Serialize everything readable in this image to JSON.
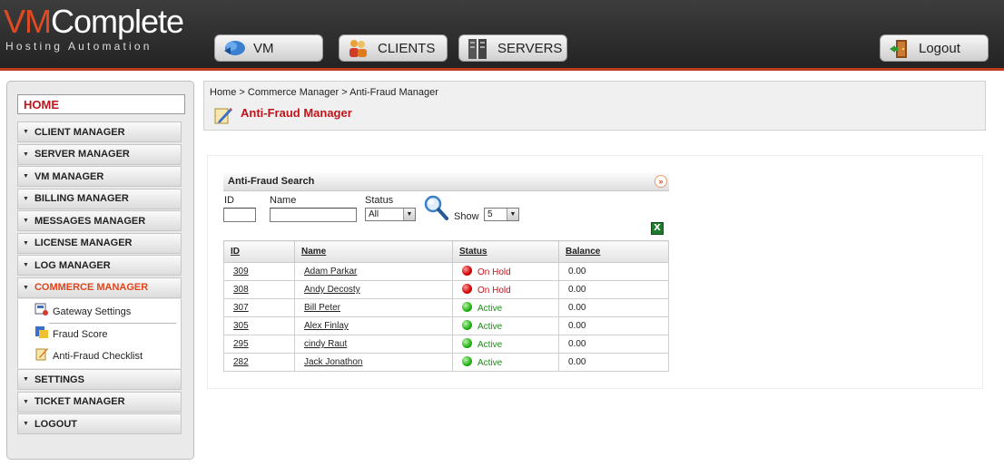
{
  "header": {
    "brand_vm": "VM",
    "brand_rest": "Complete",
    "tagline": "Hosting Automation",
    "nav": {
      "vm": "VM",
      "clients": "CLIENTS",
      "servers": "SERVERS",
      "logout": "Logout"
    }
  },
  "sidebar": {
    "home": "HOME",
    "items": [
      {
        "label": "CLIENT MANAGER"
      },
      {
        "label": "SERVER MANAGER"
      },
      {
        "label": "VM MANAGER"
      },
      {
        "label": "BILLING MANAGER"
      },
      {
        "label": "MESSAGES MANAGER"
      },
      {
        "label": "LICENSE MANAGER"
      },
      {
        "label": "LOG MANAGER"
      },
      {
        "label": "COMMERCE MANAGER"
      },
      {
        "label": "SETTINGS"
      },
      {
        "label": "TICKET MANAGER"
      },
      {
        "label": "LOGOUT"
      }
    ],
    "commerce_sub": [
      {
        "label": "Gateway Settings"
      },
      {
        "label": "Fraud Score"
      },
      {
        "label": "Anti-Fraud Checklist"
      }
    ]
  },
  "breadcrumb": "Home > Commerce Manager > Anti-Fraud Manager",
  "page_title": "Anti-Fraud Manager",
  "search": {
    "title": "Anti-Fraud Search",
    "id_label": "ID",
    "id_value": "",
    "name_label": "Name",
    "name_value": "",
    "status_label": "Status",
    "status_value": "All",
    "show_label": "Show",
    "show_value": "5"
  },
  "table": {
    "headers": [
      "ID",
      "Name",
      "Status",
      "Balance"
    ],
    "rows": [
      {
        "id": "309",
        "name": "Adam Parkar",
        "status": "On Hold",
        "balance": "0.00"
      },
      {
        "id": "308",
        "name": "Andy Decosty",
        "status": "On Hold",
        "balance": "0.00"
      },
      {
        "id": "307",
        "name": "Bill Peter",
        "status": "Active",
        "balance": "0.00"
      },
      {
        "id": "305",
        "name": "Alex Finlay",
        "status": "Active",
        "balance": "0.00"
      },
      {
        "id": "295",
        "name": "cindy Raut",
        "status": "Active",
        "balance": "0.00"
      },
      {
        "id": "282",
        "name": "Jack Jonathon",
        "status": "Active",
        "balance": "0.00"
      }
    ]
  },
  "colors": {
    "accent": "#c0141c",
    "active_menu": "#e0451b",
    "status_hold": "#c0141c",
    "status_active": "#1e8a1a"
  },
  "icons": {
    "vm": "vm-cloud-icon",
    "clients": "clients-icon",
    "servers": "servers-icon",
    "logout": "logout-door-icon",
    "search": "magnifier-icon",
    "export": "excel-icon"
  }
}
